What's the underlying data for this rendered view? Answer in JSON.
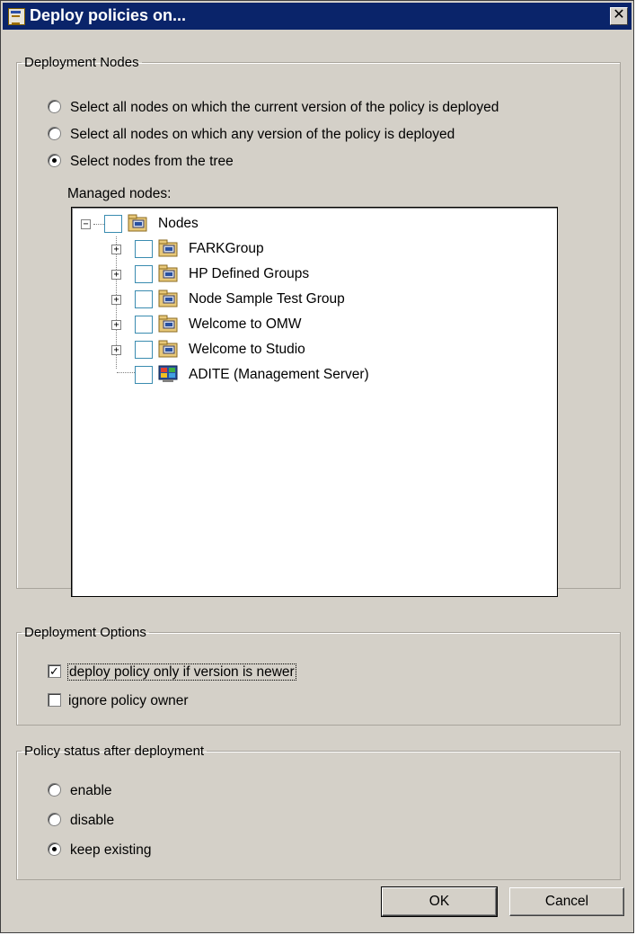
{
  "window": {
    "title": "Deploy policies on...",
    "close_glyph": "✕"
  },
  "deployment_nodes": {
    "legend": "Deployment Nodes",
    "options": [
      {
        "label": "Select all nodes on which the current version of the policy is deployed",
        "selected": false
      },
      {
        "label": "Select all nodes on which any version of the policy is deployed",
        "selected": false
      },
      {
        "label": "Select nodes from the tree",
        "selected": true
      }
    ],
    "managed_nodes_label": "Managed nodes:",
    "tree": [
      {
        "label": "Nodes",
        "level": 0,
        "expander": "−",
        "icon": "node-group-icon",
        "checked": false
      },
      {
        "label": "FARKGroup",
        "level": 1,
        "expander": "+",
        "icon": "node-group-icon",
        "checked": false
      },
      {
        "label": "HP Defined Groups",
        "level": 1,
        "expander": "+",
        "icon": "node-group-icon",
        "checked": false
      },
      {
        "label": "Node Sample Test Group",
        "level": 1,
        "expander": "+",
        "icon": "node-group-icon",
        "checked": false
      },
      {
        "label": "Welcome to OMW",
        "level": 1,
        "expander": "+",
        "icon": "node-group-icon",
        "checked": false
      },
      {
        "label": "Welcome to Studio",
        "level": 1,
        "expander": "+",
        "icon": "node-group-icon",
        "checked": false
      },
      {
        "label": "ADITE (Management Server)",
        "level": 1,
        "expander": "",
        "icon": "management-server-icon",
        "checked": false
      }
    ]
  },
  "deployment_options": {
    "legend": "Deployment Options",
    "items": [
      {
        "label": "deploy policy only if version is newer",
        "checked": true
      },
      {
        "label": "ignore policy owner",
        "checked": false
      }
    ]
  },
  "policy_status": {
    "legend": "Policy status after deployment",
    "options": [
      {
        "label": "enable",
        "selected": false
      },
      {
        "label": "disable",
        "selected": false
      },
      {
        "label": "keep existing",
        "selected": true
      }
    ]
  },
  "buttons": {
    "ok": "OK",
    "cancel": "Cancel"
  },
  "colors": {
    "titlebar": "#0a246a",
    "dialog_bg": "#d4d0c8",
    "checkbox_border": "#3a8cb0"
  }
}
